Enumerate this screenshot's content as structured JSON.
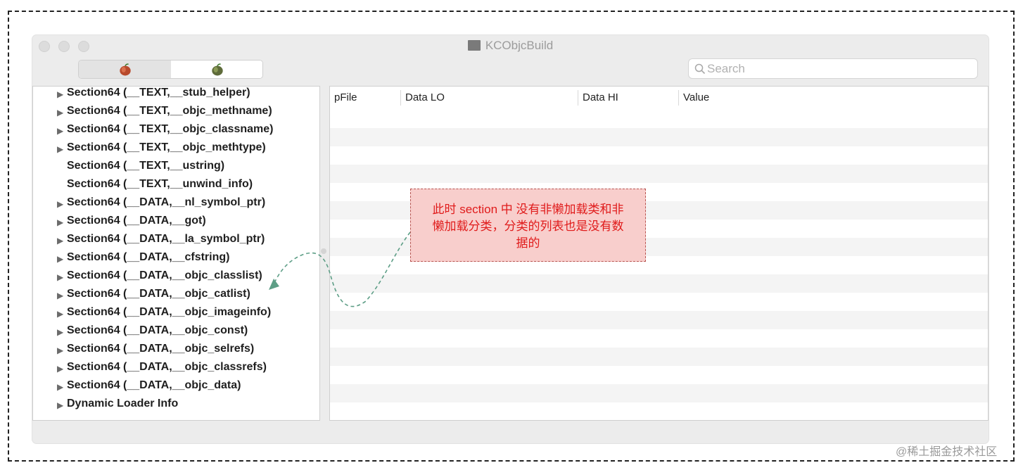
{
  "window": {
    "title": "KCObjcBuild"
  },
  "search": {
    "placeholder": "Search"
  },
  "tree": {
    "items": [
      {
        "label": "Section64 (__TEXT,__stub_helper)",
        "expandable": true
      },
      {
        "label": "Section64 (__TEXT,__objc_methname)",
        "expandable": true
      },
      {
        "label": "Section64 (__TEXT,__objc_classname)",
        "expandable": true
      },
      {
        "label": "Section64 (__TEXT,__objc_methtype)",
        "expandable": true
      },
      {
        "label": "Section64 (__TEXT,__ustring)",
        "expandable": false
      },
      {
        "label": "Section64 (__TEXT,__unwind_info)",
        "expandable": false
      },
      {
        "label": "Section64 (__DATA,__nl_symbol_ptr)",
        "expandable": true
      },
      {
        "label": "Section64 (__DATA,__got)",
        "expandable": true
      },
      {
        "label": "Section64 (__DATA,__la_symbol_ptr)",
        "expandable": true
      },
      {
        "label": "Section64 (__DATA,__cfstring)",
        "expandable": true
      },
      {
        "label": "Section64 (__DATA,__objc_classlist)",
        "expandable": true
      },
      {
        "label": "Section64 (__DATA,__objc_catlist)",
        "expandable": true
      },
      {
        "label": "Section64 (__DATA,__objc_imageinfo)",
        "expandable": true
      },
      {
        "label": "Section64 (__DATA,__objc_const)",
        "expandable": true
      },
      {
        "label": "Section64 (__DATA,__objc_selrefs)",
        "expandable": true
      },
      {
        "label": "Section64 (__DATA,__objc_classrefs)",
        "expandable": true
      },
      {
        "label": "Section64 (__DATA,__objc_data)",
        "expandable": true
      },
      {
        "label": "Dynamic Loader Info",
        "expandable": true
      }
    ]
  },
  "table": {
    "columns": [
      "pFile",
      "Data LO",
      "Data HI",
      "Value"
    ],
    "rows": []
  },
  "annotation": {
    "text_line1": "此时 section 中 没有非懒加载类和非",
    "text_line2": "懒加载分类，分类的列表也是没有数",
    "text_line3": "据的"
  },
  "watermark": "@稀土掘金技术社区",
  "colors": {
    "note_fill": "#f8cecc",
    "note_border": "#b85450",
    "note_text": "#e01b1b",
    "arrow": "#5d9e86"
  }
}
